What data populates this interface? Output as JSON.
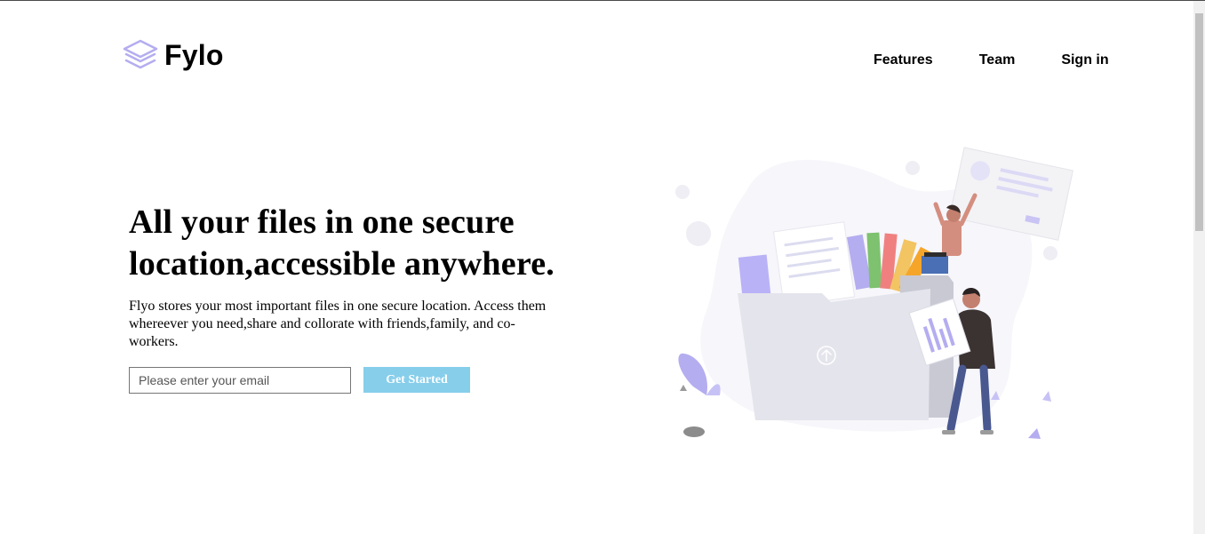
{
  "brand": {
    "name": "Fylo"
  },
  "nav": {
    "items": [
      "Features",
      "Team",
      "Sign in"
    ]
  },
  "hero": {
    "headline": "All your files in one secure location,accessible anywhere.",
    "description": "Flyo stores your most important files in one secure location. Access them whereever you need,share and collorate with friends,family, and co-workers.",
    "email_placeholder": "Please enter your email",
    "cta_label": "Get Started"
  },
  "colors": {
    "cta": "#87ceeb",
    "logo": "#b4adf0",
    "accent_purple": "#6c63ff"
  },
  "icons": {
    "logo": "stacked-layers-icon",
    "upload": "upload-arrow-icon"
  }
}
